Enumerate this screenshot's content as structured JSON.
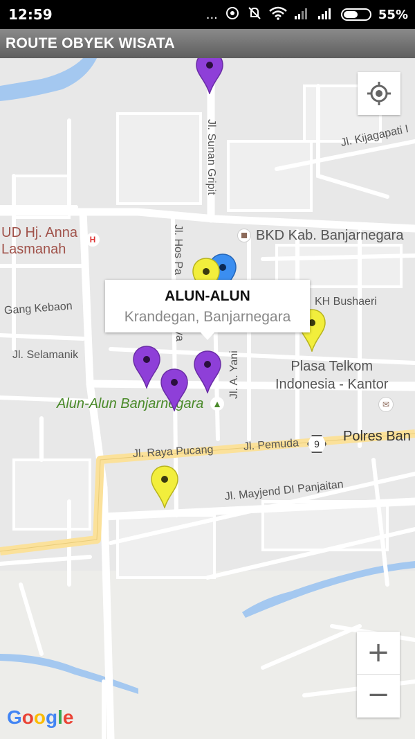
{
  "status_bar": {
    "time": "12:59",
    "dots": "...",
    "battery_percent": "55%",
    "battery_level": 0.55
  },
  "app_bar": {
    "title": "ROUTE OBYEK WISATA"
  },
  "map": {
    "labels": {
      "hospital": "UD Hj. Anna\nLasmanah",
      "bkd": "BKD Kab. Banjarnegara",
      "kh_bushaeri": "KH Bushaeri",
      "gang_kebaon": "Gang Kebaon",
      "jl_selamanik": "Jl. Selamanik",
      "plasa_telkom": "Plasa Telkom\nIndonesia - Kantor",
      "alun_alun_park": "Alun-Alun Banjarnegara",
      "jl_raya_pucang": "Jl. Raya Pucang",
      "jl_pemuda": "Jl. Pemuda",
      "route_number": "9",
      "polres": "Polres Ban",
      "jl_mayjend": "Jl. Mayjend DI Panjaitan",
      "jl_a_yani": "Jl. A. Yani",
      "jl_sunan_gripit": "Jl. Sunan Gripit",
      "jl_hos": "Jl. Hos Pa",
      "ya_fragment": "ya",
      "jl_kijagapati": "Jl. Kijagapati I",
      "hospital_badge": "H"
    },
    "info_window": {
      "title": "ALUN-ALUN",
      "subtitle": "Krandegan, Banjarnegara"
    },
    "controls": {
      "zoom_in": "+",
      "zoom_out": "−"
    },
    "attribution": {
      "g1": "G",
      "o1": "o",
      "o2": "o",
      "g2": "g",
      "l": "l",
      "e": "e"
    },
    "colors": {
      "pin_purple": "#8e3fd8",
      "pin_yellow": "#f2ee3c",
      "pin_blue": "#3b8ef0",
      "water": "#a4c8f0",
      "major_road": "#fbe19a",
      "road": "#ffffff",
      "park": "#4a8a2a"
    }
  }
}
